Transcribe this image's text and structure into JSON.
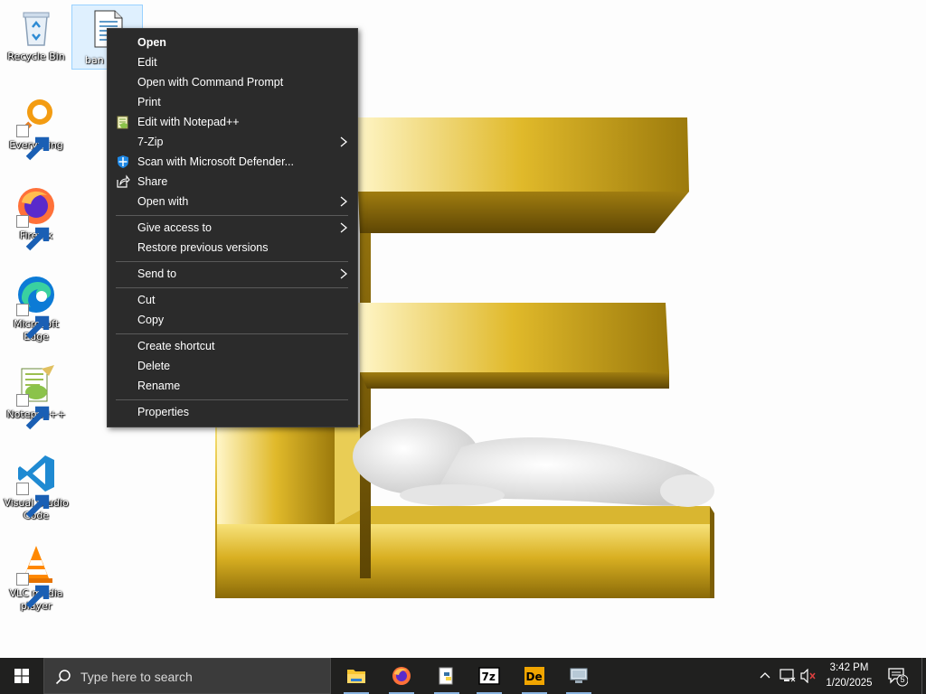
{
  "desktop": {
    "icons": [
      {
        "label": "Recycle Bin"
      },
      {
        "label": "Everything"
      },
      {
        "label": "Firefox"
      },
      {
        "label": "Microsoft Edge"
      },
      {
        "label": "Notepad++"
      },
      {
        "label": "Visual Studio Code"
      },
      {
        "label": "VLC media player"
      }
    ],
    "selected_file": {
      "label": "ban"
    }
  },
  "context_menu": {
    "items": [
      {
        "label": "Open",
        "bold": true
      },
      {
        "label": "Edit"
      },
      {
        "label": "Open with Command Prompt"
      },
      {
        "label": "Print"
      },
      {
        "label": "Edit with Notepad++",
        "icon": "notepadpp-icon"
      },
      {
        "label": "7-Zip",
        "submenu": true
      },
      {
        "label": "Scan with Microsoft Defender...",
        "icon": "defender-shield-icon"
      },
      {
        "label": "Share",
        "icon": "share-icon"
      },
      {
        "label": "Open with",
        "submenu": true
      },
      {
        "label": "Give access to",
        "submenu": true
      },
      {
        "label": "Restore previous versions"
      },
      {
        "label": "Send to",
        "submenu": true
      },
      {
        "label": "Cut"
      },
      {
        "label": "Copy"
      },
      {
        "label": "Create shortcut"
      },
      {
        "label": "Delete"
      },
      {
        "label": "Rename"
      },
      {
        "label": "Properties"
      }
    ]
  },
  "taskbar": {
    "search_placeholder": "Type here to search",
    "pinned_apps": [
      "File Explorer",
      "Firefox",
      "Python",
      "7-Zip",
      "DependencyWalker",
      "Network app"
    ],
    "clock": {
      "time": "3:42 PM",
      "date": "1/20/2025"
    },
    "notification_count": "5"
  },
  "colors": {
    "taskbar": "#20201f",
    "menu_bg": "#2b2b2b",
    "gold": "#c9a11a"
  }
}
